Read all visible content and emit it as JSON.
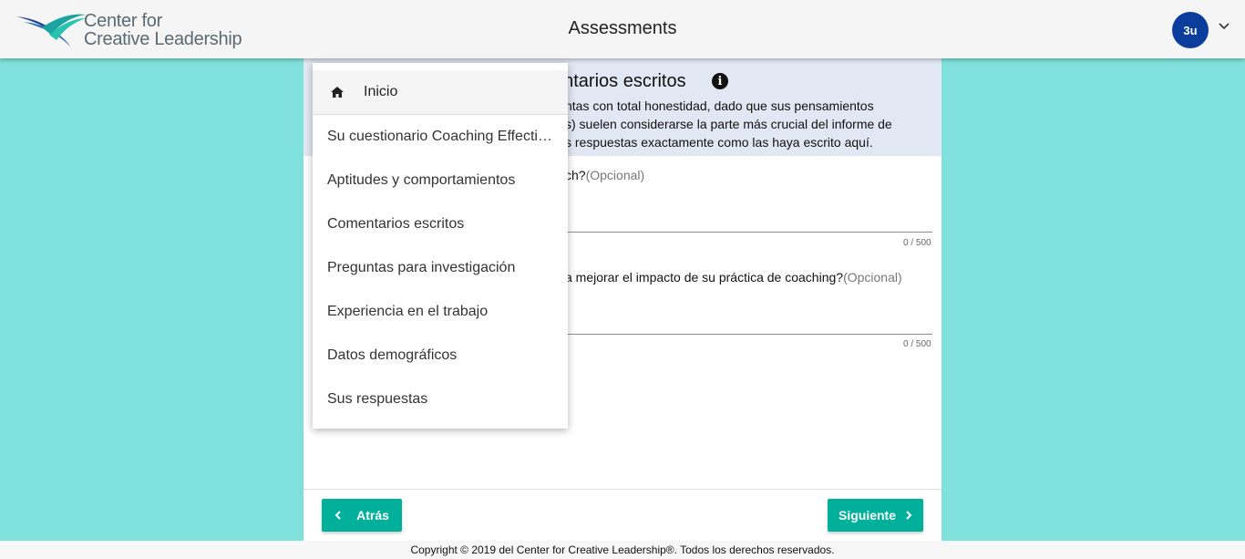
{
  "header": {
    "logo_line1": "Center for",
    "logo_line2": "Creative Leadership",
    "title": "Assessments",
    "avatar_initials": "3u",
    "avatar_color": "#0b3e9c"
  },
  "banner": {
    "title_visible": "entarios escritos",
    "line1": "ntas con total honestidad, dado que sus pensamientos",
    "line2": "s) suelen considerarse la parte más crucial del informe de",
    "line3": "s respuestas exactamente como las haya escrito aquí.",
    "background": "#e1e7f3"
  },
  "questions": [
    {
      "text_visible": "ch?",
      "optional": "(Opcional)",
      "counter": "0 / 500"
    },
    {
      "text_visible": "a mejorar el impacto de su práctica de coaching?",
      "optional": "(Opcional)",
      "counter": "0 / 500"
    }
  ],
  "nav": {
    "back_label": "Atrás",
    "next_label": "Siguiente",
    "accent": "#00b09b"
  },
  "menu": {
    "home_label": "Inicio",
    "items": [
      "Su cuestionario Coaching Effectiveness",
      "Aptitudes y comportamientos",
      "Comentarios escritos",
      "Preguntas para investigación",
      "Experiencia en el trabajo",
      "Datos demográficos",
      "Sus respuestas"
    ]
  },
  "footer": {
    "copyright": "Copyright © 2019 del Center for Creative Leadership®. Todos los derechos reservados."
  },
  "colors": {
    "page_background": "#80e0db"
  }
}
